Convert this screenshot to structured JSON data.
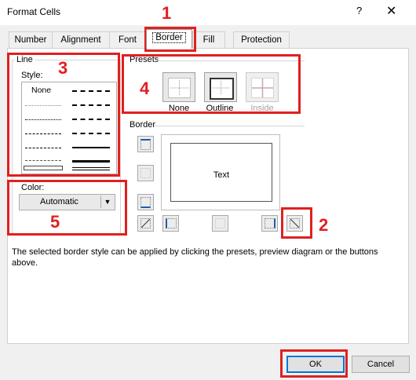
{
  "window": {
    "title": "Format Cells",
    "help_label": "?",
    "close_label": "✕"
  },
  "tabs": [
    {
      "label": "Number"
    },
    {
      "label": "Alignment"
    },
    {
      "label": "Font"
    },
    {
      "label": "Border"
    },
    {
      "label": "Fill"
    },
    {
      "label": "Protection"
    }
  ],
  "line": {
    "group_label": "Line",
    "style_label": "Style:",
    "none_label": "None",
    "color_label": "Color:",
    "color_value": "Automatic"
  },
  "presets": {
    "group_label": "Presets",
    "items": [
      {
        "label_u": "N",
        "label_rest": "one"
      },
      {
        "label_u": "O",
        "label_rest": "utline"
      },
      {
        "label_u": "",
        "label_rest": "Inside"
      }
    ]
  },
  "border": {
    "group_label": "Border",
    "preview_text": "Text"
  },
  "info_text": "The selected border style can be applied by clicking the presets, preview diagram or the buttons above.",
  "buttons": {
    "ok": "OK",
    "cancel": "Cancel"
  },
  "annotations": {
    "n1": "1",
    "n2": "2",
    "n3": "3",
    "n4": "4",
    "n5": "5"
  },
  "colors": {
    "annotation_red": "#e02020",
    "accent": "#0078d7"
  }
}
